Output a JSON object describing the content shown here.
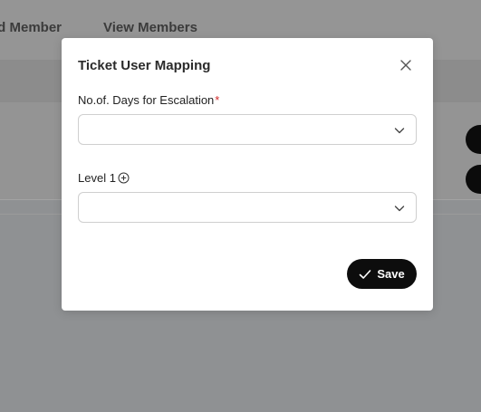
{
  "background": {
    "tabs": [
      {
        "label": "dd Member"
      },
      {
        "label": "View Members"
      }
    ]
  },
  "modal": {
    "title": "Ticket User Mapping",
    "close_icon": "close-icon",
    "fields": {
      "days": {
        "label": "No.of. Days for Escalation",
        "required_mark": "*",
        "value": "",
        "chevron_icon": "chevron-down-icon"
      },
      "level": {
        "label": "Level 1",
        "add_icon": "plus-circle-icon",
        "value": "",
        "chevron_icon": "chevron-down-icon"
      }
    },
    "save": {
      "label": "Save",
      "icon": "check-icon"
    }
  },
  "colors": {
    "overlay_background": "#8f9193",
    "modal_background": "#ffffff",
    "primary_button": "#0d0d0d",
    "required_mark": "#d12a2a"
  }
}
